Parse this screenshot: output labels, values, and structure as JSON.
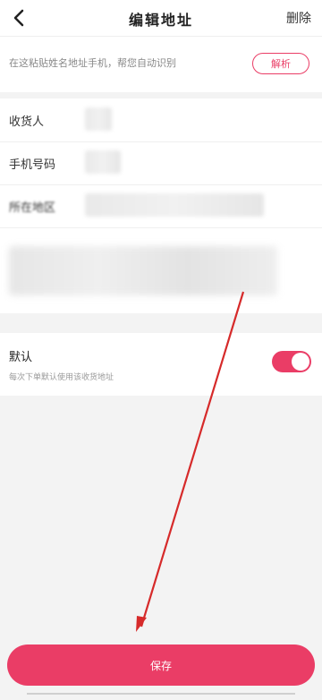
{
  "header": {
    "title": "编辑地址",
    "delete_label": "删除",
    "back_icon": "chevron-left-icon"
  },
  "paste": {
    "hint": "在这粘贴姓名地址手机，帮您自动识别",
    "parse_button": "解析"
  },
  "form": {
    "fields": [
      {
        "label": "收货人"
      },
      {
        "label": "手机号码"
      },
      {
        "label": "所在地区"
      }
    ]
  },
  "default": {
    "title": "默认",
    "subtitle": "每次下单默认使用该收货地址",
    "enabled": true
  },
  "actions": {
    "save_label": "保存"
  },
  "colors": {
    "accent": "#ea3d66",
    "annotation_arrow": "#d62a2a"
  }
}
